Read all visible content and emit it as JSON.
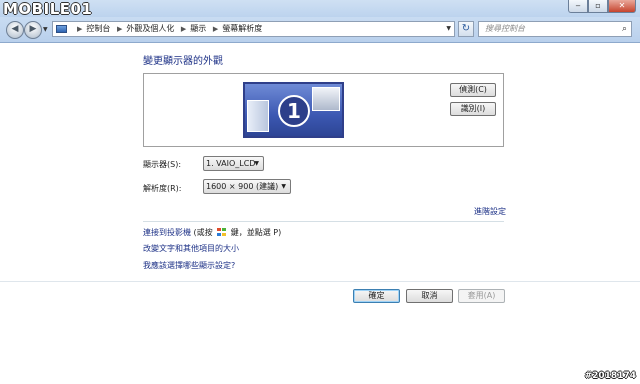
{
  "window": {
    "logo_text": "MOBILE01",
    "minimize_glyph": "‒",
    "maximize_glyph": "▫",
    "close_glyph": "✕"
  },
  "nav": {
    "back_glyph": "◀",
    "forward_glyph": "▶",
    "address_icon": "control-panel-icon",
    "breadcrumbs": [
      "控制台",
      "外觀及個人化",
      "顯示",
      "螢幕解析度"
    ],
    "refresh_glyph": "↻",
    "search_placeholder": "搜尋控制台",
    "search_icon_glyph": "⌕"
  },
  "main": {
    "title": "變更顯示器的外觀",
    "monitor_number": "1",
    "detect_button": "偵測(C)",
    "identify_button": "識別(I)",
    "display_label": "顯示器(S):",
    "display_value": "1. VAIO_LCD",
    "resolution_label": "解析度(R):",
    "resolution_value": "1600 × 900 (建議)",
    "advanced_link": "進階設定",
    "projector_link": "連接到投影機",
    "projector_hint_before": " (或按 ",
    "projector_hint_after": " 鍵，並點選 P)",
    "text_size_link": "改變文字和其他項目的大小",
    "which_settings_link": "我應該選擇哪些顯示設定?"
  },
  "footer": {
    "ok_button": "確定",
    "cancel_button": "取消",
    "apply_button": "套用(A)"
  },
  "watermark": "#2018174",
  "colors": {
    "link": "#1e3287",
    "title": "#1e3287",
    "monitor": "#3c58b2",
    "titlebar": "#bcd3ee"
  }
}
